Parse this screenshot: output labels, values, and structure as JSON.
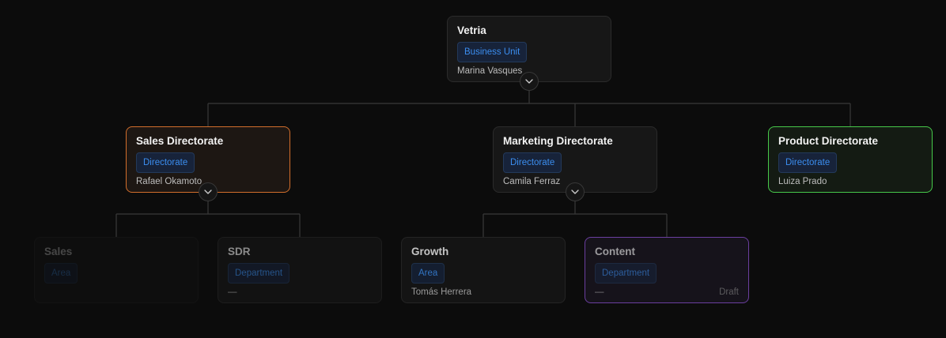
{
  "nodes": {
    "vetria": {
      "title": "Vetria",
      "badge": "Business Unit",
      "person": "Marina Vasques"
    },
    "sales_directorate": {
      "title": "Sales Directorate",
      "badge": "Directorate",
      "person": "Rafael Okamoto"
    },
    "marketing_directorate": {
      "title": "Marketing Directorate",
      "badge": "Directorate",
      "person": "Camila Ferraz"
    },
    "product_directorate": {
      "title": "Product Directorate",
      "badge": "Directorate",
      "person": "Luiza Prado"
    },
    "sales": {
      "title": "Sales",
      "badge": "Area",
      "person": ""
    },
    "sdr": {
      "title": "SDR",
      "badge": "Department",
      "person": "—"
    },
    "growth": {
      "title": "Growth",
      "badge": "Area",
      "person": "Tomás Herrera"
    },
    "content": {
      "title": "Content",
      "badge": "Department",
      "person": "—",
      "status": "Draft"
    }
  },
  "colors": {
    "background": "#0c0c0c",
    "node_border": "#2b2b2b",
    "selected_orange": "#d36f2c",
    "selected_green": "#47c94a",
    "selected_purple": "#6b3fa0",
    "badge_text": "#3b8ef0",
    "connector": "#3a3a3a"
  },
  "icons": {
    "toggle": "chevron-down-icon"
  }
}
